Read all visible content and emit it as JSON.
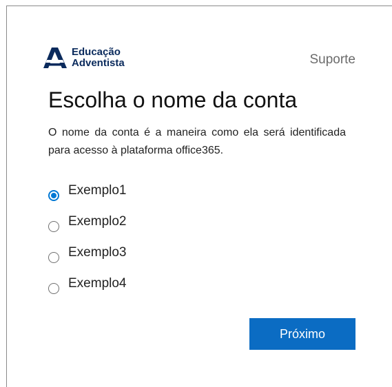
{
  "header": {
    "logo_line1": "Educação",
    "logo_line2": "Adventista",
    "support_link": "Suporte"
  },
  "main": {
    "title": "Escolha o nome da conta",
    "description": "O nome da conta é a maneira como ela será identificada para acesso à plataforma office365.",
    "options": [
      {
        "label": "Exemplo1",
        "selected": true
      },
      {
        "label": "Exemplo2",
        "selected": false
      },
      {
        "label": "Exemplo3",
        "selected": false
      },
      {
        "label": "Exemplo4",
        "selected": false
      }
    ],
    "next_label": "Próximo"
  },
  "colors": {
    "accent": "#0078d4",
    "button": "#0b6cc3",
    "logo": "#0a2a5c"
  }
}
